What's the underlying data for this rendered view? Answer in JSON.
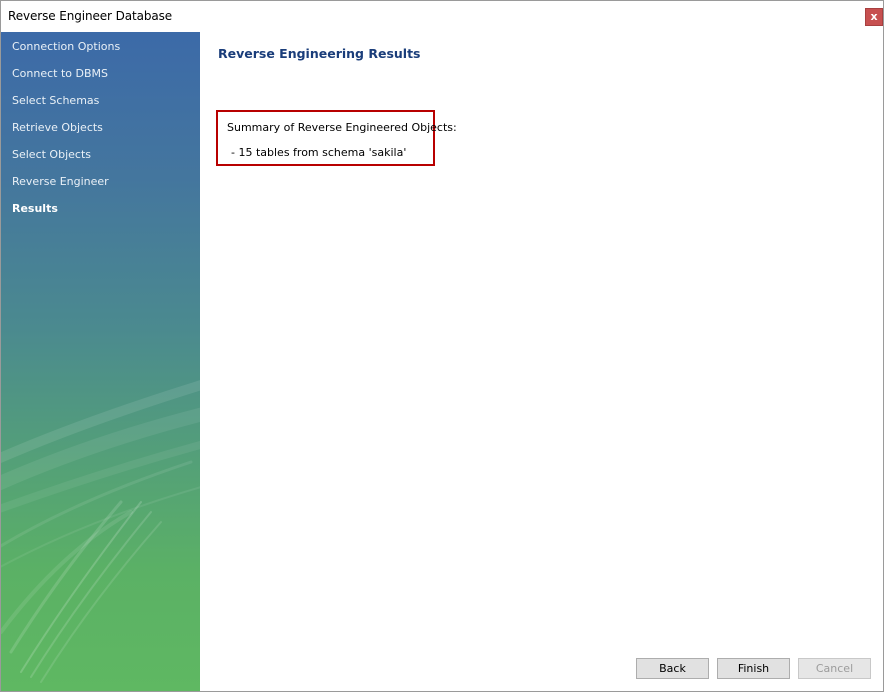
{
  "window": {
    "title": "Reverse Engineer Database",
    "close_label": "x"
  },
  "sidebar": {
    "steps": [
      {
        "label": "Connection Options",
        "active": false
      },
      {
        "label": "Connect to DBMS",
        "active": false
      },
      {
        "label": "Select Schemas",
        "active": false
      },
      {
        "label": "Retrieve Objects",
        "active": false
      },
      {
        "label": "Select Objects",
        "active": false
      },
      {
        "label": "Reverse Engineer",
        "active": false
      },
      {
        "label": "Results",
        "active": true
      }
    ]
  },
  "main": {
    "title": "Reverse Engineering Results",
    "summary": {
      "heading": "Summary of Reverse Engineered Objects:",
      "lines": [
        " - 15 tables from schema 'sakila'"
      ]
    }
  },
  "footer": {
    "back_label": "Back",
    "finish_label": "Finish",
    "cancel_label": "Cancel",
    "cancel_enabled": false
  },
  "colors": {
    "accent_title": "#1a3d7a",
    "highlight_border": "#b80000",
    "sidebar_top": "#3c6aa8",
    "sidebar_bottom": "#5fb862"
  }
}
